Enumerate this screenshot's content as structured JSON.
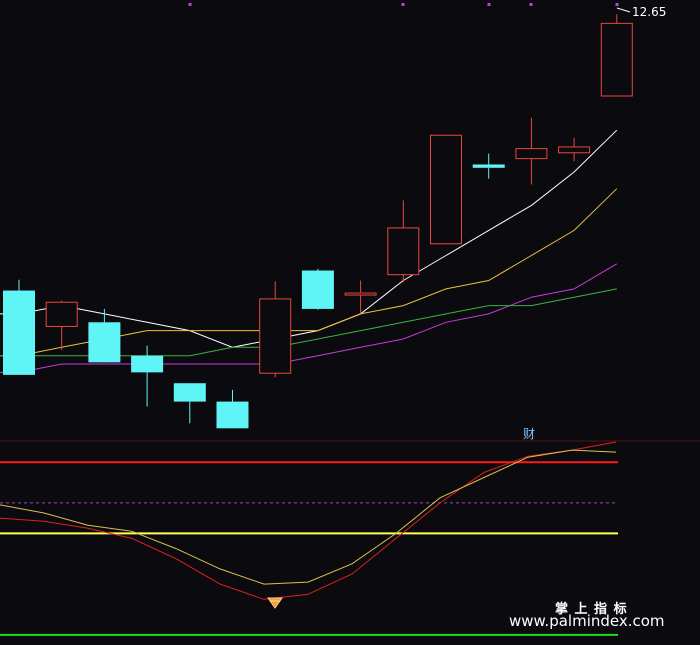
{
  "colors": {
    "background": "#0b0a0f",
    "up_candle": "#e8483c",
    "down_candle": "#5ff4f6",
    "ma_white": "#ffffff",
    "ma_yellow": "#e9c23a",
    "ma_magenta": "#c93bd8",
    "ma_green": "#3fb13f",
    "osc_red": "#e02020",
    "osc_yellow": "#d9c24a",
    "level_red": "#ff1a1a",
    "level_yellow": "#ffff55",
    "level_green": "#22dd22",
    "level_purple": "#b040c0",
    "divider": "#5a1010"
  },
  "labels": {
    "last_price": "12.65",
    "cai_marker": "财",
    "watermark_title": "掌 上 指 标",
    "watermark_url": "www.palmindex.com"
  },
  "chart_data": [
    {
      "type": "candlestick",
      "title": "",
      "y_range": [
        7.49,
        12.7
      ],
      "candles": [
        {
          "open": 9.28,
          "high": 9.41,
          "low": 8.27,
          "close": 8.27
        },
        {
          "open": 8.85,
          "high": 9.16,
          "low": 8.57,
          "close": 9.14
        },
        {
          "open": 8.9,
          "high": 9.06,
          "low": 8.45,
          "close": 8.42
        },
        {
          "open": 8.5,
          "high": 8.62,
          "low": 7.89,
          "close": 8.3
        },
        {
          "open": 8.17,
          "high": 8.17,
          "low": 7.69,
          "close": 7.95
        },
        {
          "open": 7.95,
          "high": 8.09,
          "low": 7.69,
          "close": 7.63
        },
        {
          "open": 8.29,
          "high": 9.39,
          "low": 8.24,
          "close": 9.18
        },
        {
          "open": 9.52,
          "high": 9.54,
          "low": 9.05,
          "close": 9.06
        },
        {
          "open": 9.24,
          "high": 9.4,
          "low": 9.01,
          "close": 9.25
        },
        {
          "open": 9.47,
          "high": 10.36,
          "low": 9.38,
          "close": 10.03
        },
        {
          "open": 9.84,
          "high": 11.09,
          "low": 10.55,
          "close": 11.14
        },
        {
          "open": 10.79,
          "high": 10.92,
          "low": 10.62,
          "close": 10.75
        },
        {
          "open": 10.86,
          "high": 11.35,
          "low": 10.55,
          "close": 10.98
        },
        {
          "open": 10.93,
          "high": 11.11,
          "low": 10.83,
          "close": 11.0
        },
        {
          "open": 11.61,
          "high": 12.59,
          "low": 11.61,
          "close": 12.48
        }
      ],
      "moving_averages": [
        {
          "color_key": "ma_white",
          "values": [
            9.0,
            9.1,
            9.0,
            8.9,
            8.8,
            8.6,
            8.7,
            8.8,
            9.0,
            9.4,
            9.7,
            10.0,
            10.3,
            10.7,
            11.2
          ]
        },
        {
          "color_key": "ma_yellow",
          "values": [
            8.5,
            8.6,
            8.7,
            8.8,
            8.8,
            8.8,
            8.8,
            8.8,
            9.0,
            9.1,
            9.3,
            9.4,
            9.7,
            10.0,
            10.5
          ]
        },
        {
          "color_key": "ma_magenta",
          "values": [
            8.3,
            8.4,
            8.4,
            8.4,
            8.4,
            8.4,
            8.4,
            8.5,
            8.6,
            8.7,
            8.9,
            9.0,
            9.2,
            9.3,
            9.6
          ]
        },
        {
          "color_key": "ma_green",
          "values": [
            8.5,
            8.5,
            8.5,
            8.5,
            8.5,
            8.6,
            8.6,
            8.7,
            8.8,
            8.9,
            9.0,
            9.1,
            9.1,
            9.2,
            9.3
          ]
        }
      ]
    },
    {
      "type": "line",
      "title": "",
      "y_range": [
        0,
        200
      ],
      "series": [
        {
          "color_key": "osc_red",
          "values": [
            125,
            122,
            115,
            105,
            85,
            60,
            45,
            50,
            70,
            105,
            140,
            170,
            186,
            192,
            200
          ]
        },
        {
          "color_key": "osc_yellow",
          "values": [
            138,
            130,
            118,
            112,
            95,
            75,
            60,
            62,
            80,
            110,
            145,
            165,
            185,
            192,
            190
          ]
        }
      ],
      "levels": [
        {
          "value": 180,
          "color_key": "level_red"
        },
        {
          "value": 140,
          "color_key": "level_purple",
          "style": "dashed"
        },
        {
          "value": 110,
          "color_key": "level_yellow"
        },
        {
          "value": 10,
          "color_key": "level_green"
        }
      ]
    }
  ]
}
